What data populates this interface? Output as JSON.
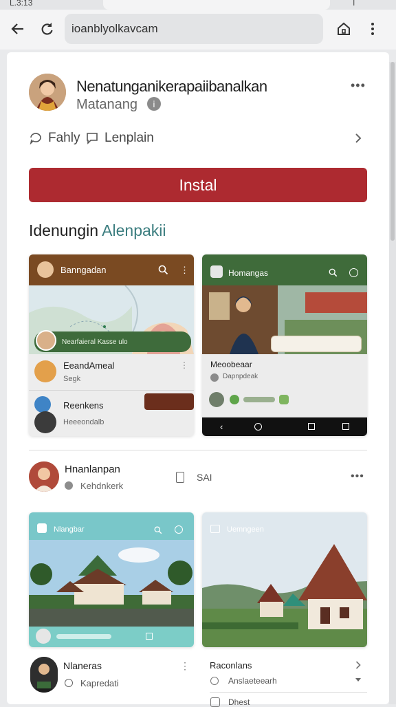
{
  "statusbar": {
    "time": "L.3:13",
    "right": "l"
  },
  "browser": {
    "url": "ioanblyolkavcam"
  },
  "app": {
    "title": "Nenatunganikerapaiibanalkan",
    "subtitle": "Matanang",
    "actions": [
      {
        "label": "Fahly"
      },
      {
        "label": "Lenplain"
      }
    ],
    "install_label": "Instal"
  },
  "section": {
    "title_dark": "Idenungin",
    "title_accent": "Alenpakii",
    "accent_color": "#3b7d7f"
  },
  "shot1": {
    "header": "Banngadan",
    "map_caption": "Nearfaieral Kasse ulo",
    "items": [
      {
        "title": "EeandAmeal",
        "meta": "Segk"
      },
      {
        "title": "Reenkens",
        "meta": "Heeeondalb"
      }
    ]
  },
  "shot2": {
    "header": "Homangas",
    "items": [
      {
        "title": "Meoobeaar",
        "meta": "Dapnpdeak"
      }
    ]
  },
  "post": {
    "name": "Hnanlanpan",
    "meta": "Kehdnkerk",
    "badge": "SAI"
  },
  "shot3": {
    "header": "Nlangbar"
  },
  "shot4": {
    "header": "Uemngeen"
  },
  "bottom": {
    "left": {
      "title": "Nlaneras",
      "meta": "Kapredati"
    },
    "right": {
      "title": "Raconlans",
      "meta": "Anslaeteearh",
      "extra": "Dhest"
    }
  },
  "colors": {
    "install": "#ad2a30",
    "brown": "#7a4a22",
    "green": "#3f6b3a",
    "teal": "#7ccdc7"
  },
  "icons": [
    "back-icon",
    "reload-icon",
    "home-icon",
    "more-vert-icon",
    "info-icon",
    "chat-icon",
    "chevron-right-icon",
    "search-icon"
  ]
}
